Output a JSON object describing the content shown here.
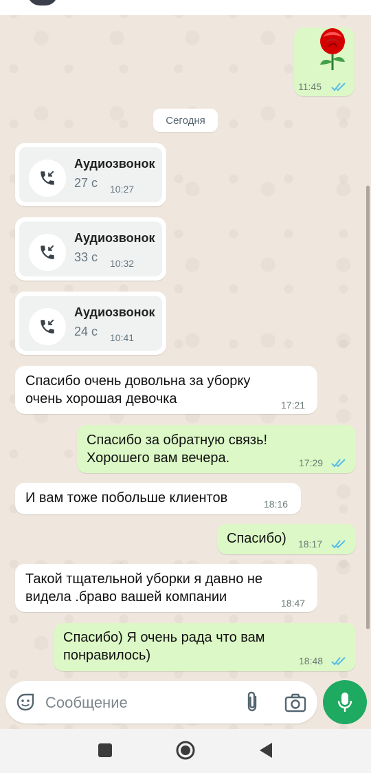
{
  "colors": {
    "incoming": "#ffffff",
    "outgoing": "#dcf8c6",
    "accent": "#1eaa61",
    "read_ticks": "#53bdeb"
  },
  "sticker": {
    "icon": "rose-sticker",
    "time": "11:45"
  },
  "date_divider": "Сегодня",
  "calls": [
    {
      "title": "Аудиозвонок",
      "duration": "27 с",
      "time": "10:27"
    },
    {
      "title": "Аудиозвонок",
      "duration": "33 с",
      "time": "10:32"
    },
    {
      "title": "Аудиозвонок",
      "duration": "24 с",
      "time": "10:41"
    }
  ],
  "messages": [
    {
      "direction": "in",
      "text": "Спасибо очень довольна за уборку\nочень хорошая девочка",
      "time": "17:21"
    },
    {
      "direction": "out",
      "text": "Спасибо за обратную связь!\nХорошего вам вечера.",
      "time": "17:29"
    },
    {
      "direction": "in",
      "text": "И вам тоже побольше клиентов",
      "time": "18:16"
    },
    {
      "direction": "out",
      "text": "Спасибо)",
      "time": "18:17"
    },
    {
      "direction": "in",
      "text": "Такой тщательной уборки я давно не\nвидела .браво вашей компании",
      "time": "18:47"
    },
    {
      "direction": "out",
      "text": "Спасибо) Я очень рада что вам\nпонравилось)",
      "time": "18:48"
    }
  ],
  "composer": {
    "placeholder": "Сообщение"
  },
  "icons": {
    "emoji": "sticker-icon",
    "attach": "paperclip-icon",
    "camera": "camera-icon",
    "mic": "microphone-icon",
    "nav_recent": "square-icon",
    "nav_home": "circle-icon",
    "nav_back": "triangle-back-icon"
  }
}
